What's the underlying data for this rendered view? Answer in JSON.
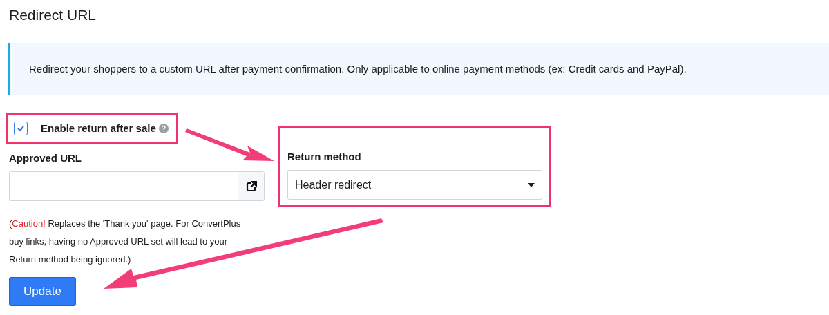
{
  "title": "Redirect URL",
  "notice": "Redirect your shoppers to a custom URL after payment confirmation. Only applicable to online payment methods (ex: Credit cards and PayPal).",
  "enable_return": {
    "label": "Enable return after sale",
    "checked": true
  },
  "approved_url": {
    "label": "Approved URL"
  },
  "return_method": {
    "label": "Return method",
    "value": "Header redirect"
  },
  "note": {
    "lead": "(",
    "warning": "Caution!",
    "body": " Replaces the 'Thank you' page. For ConvertPlus buy links, having no Approved URL set will lead to your Return method being ignored.)"
  },
  "button": "Update"
}
